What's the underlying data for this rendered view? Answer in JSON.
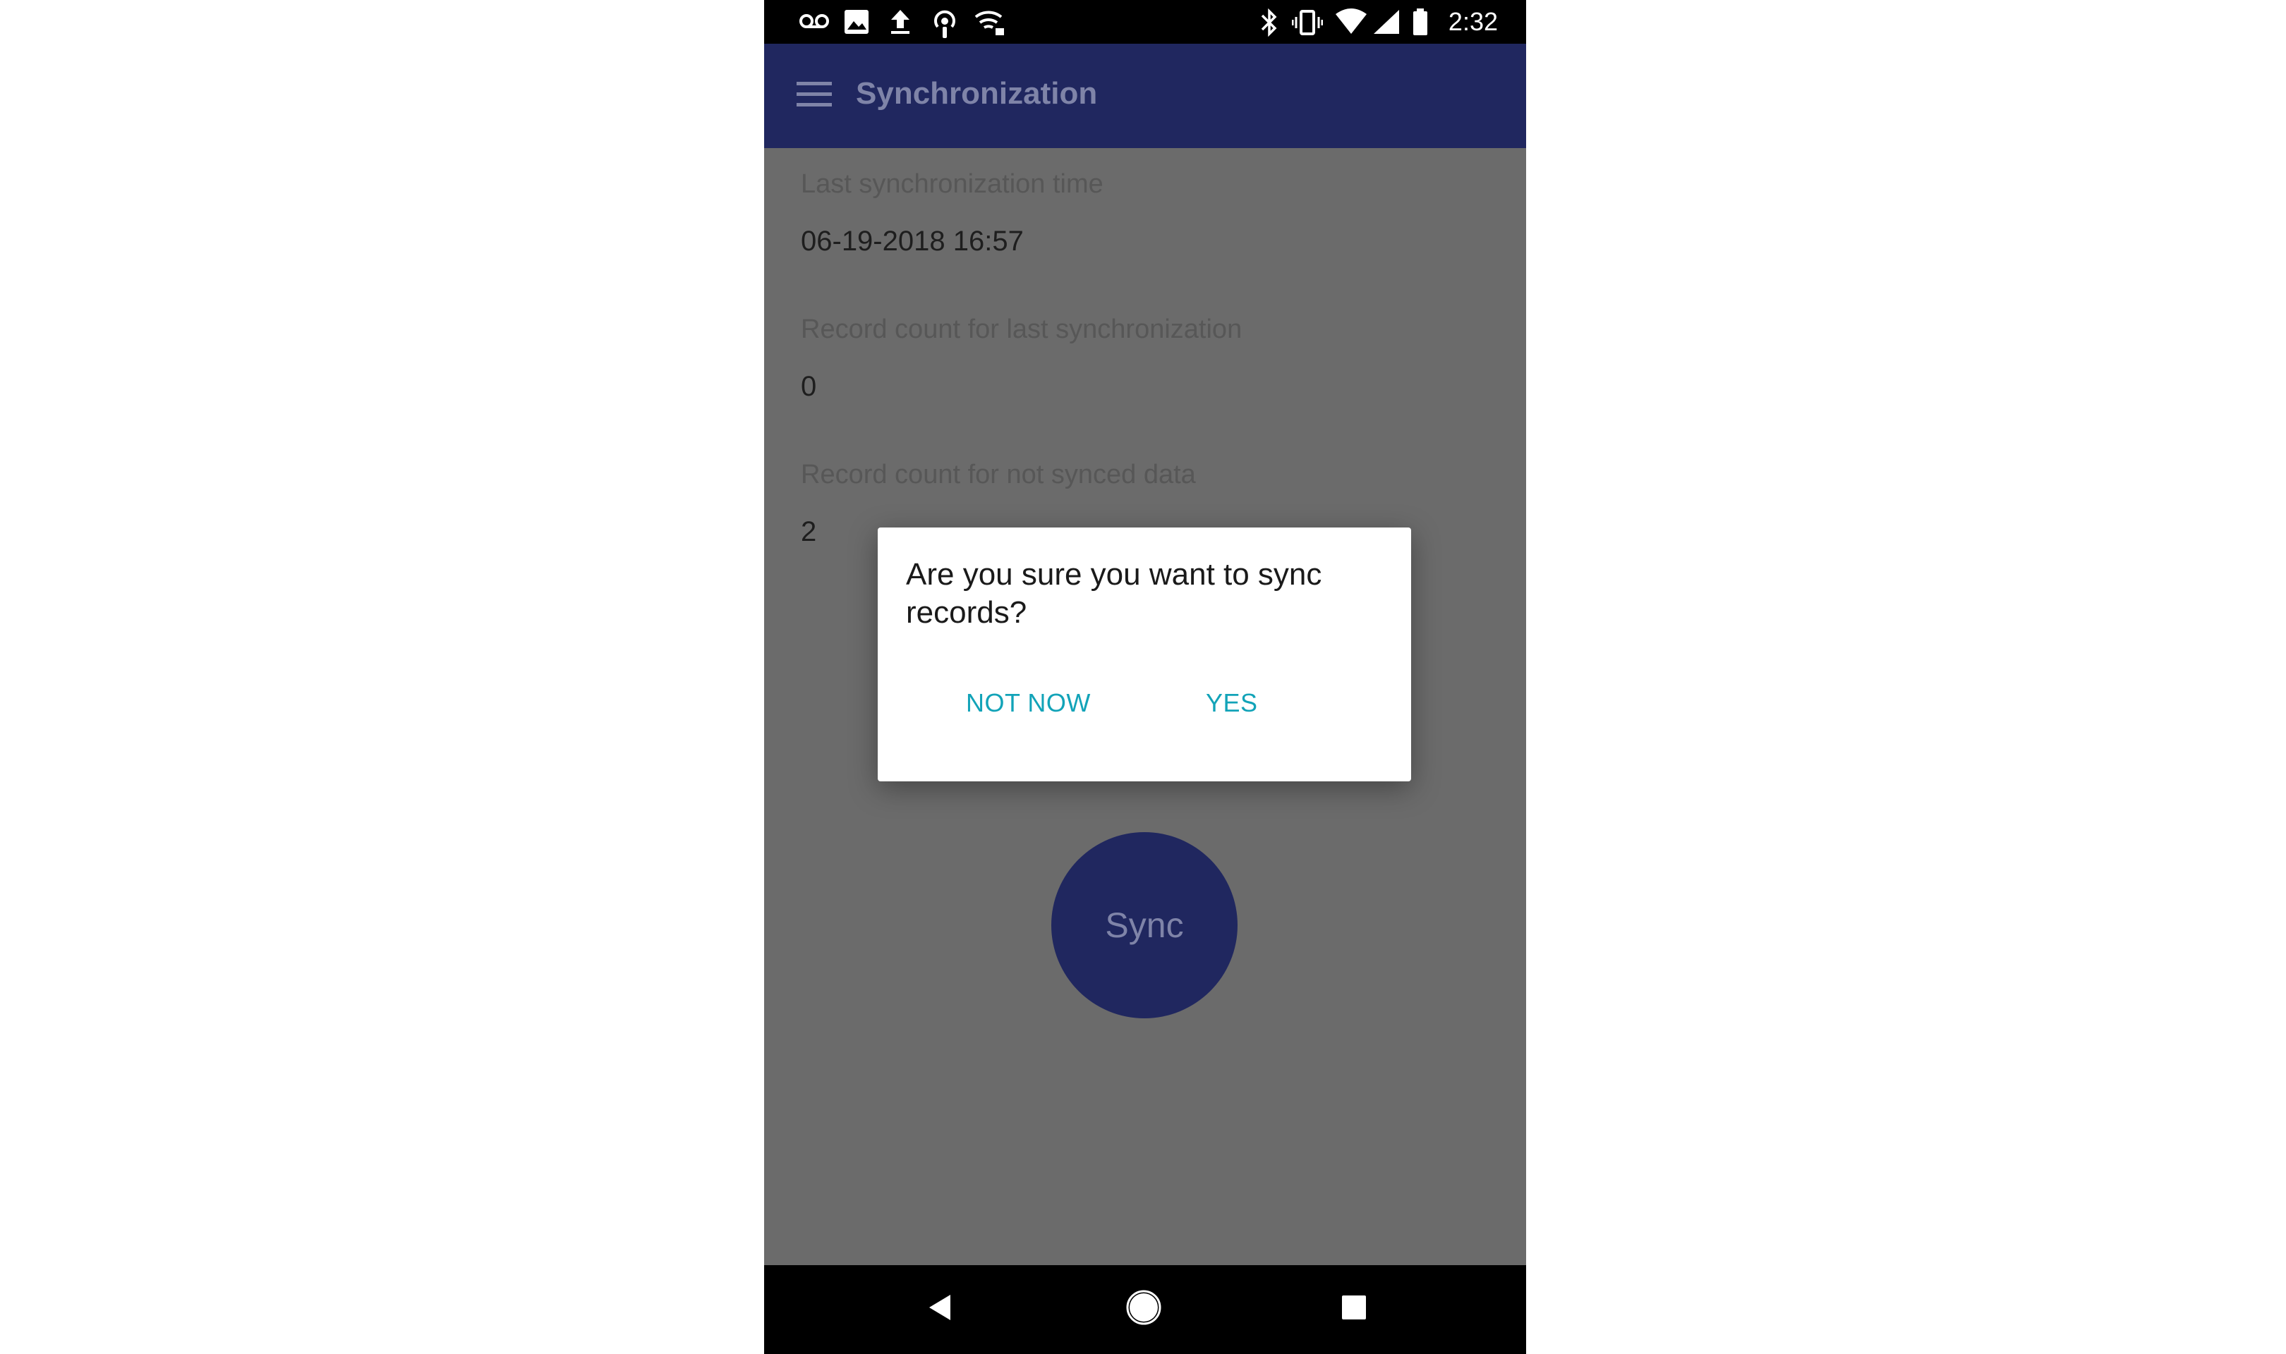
{
  "status_bar": {
    "time": "2:32",
    "left_icons": [
      "voicemail-icon",
      "image-icon",
      "upload-icon",
      "podcast-icon",
      "wifi-lock-icon"
    ],
    "right_icons": [
      "bluetooth-icon",
      "vibrate-icon",
      "wifi-icon",
      "signal-icon",
      "battery-icon"
    ]
  },
  "app_bar": {
    "title": "Synchronization",
    "menu_icon": "menu-icon",
    "background": "#20275f"
  },
  "fields": [
    {
      "label": "Last synchronization time",
      "value": "06-19-2018 16:57"
    },
    {
      "label": "Record count for last synchronization",
      "value": "0"
    },
    {
      "label": "Record count for not synced data",
      "value": "2"
    }
  ],
  "sync_button": {
    "label": "Sync"
  },
  "dialog": {
    "message": "Are you sure you want to sync records?",
    "negative_label": "NOT NOW",
    "positive_label": "YES",
    "accent_color": "#12a3b8"
  },
  "nav_bar": {
    "buttons": [
      "back-icon",
      "home-icon",
      "recents-icon"
    ]
  }
}
